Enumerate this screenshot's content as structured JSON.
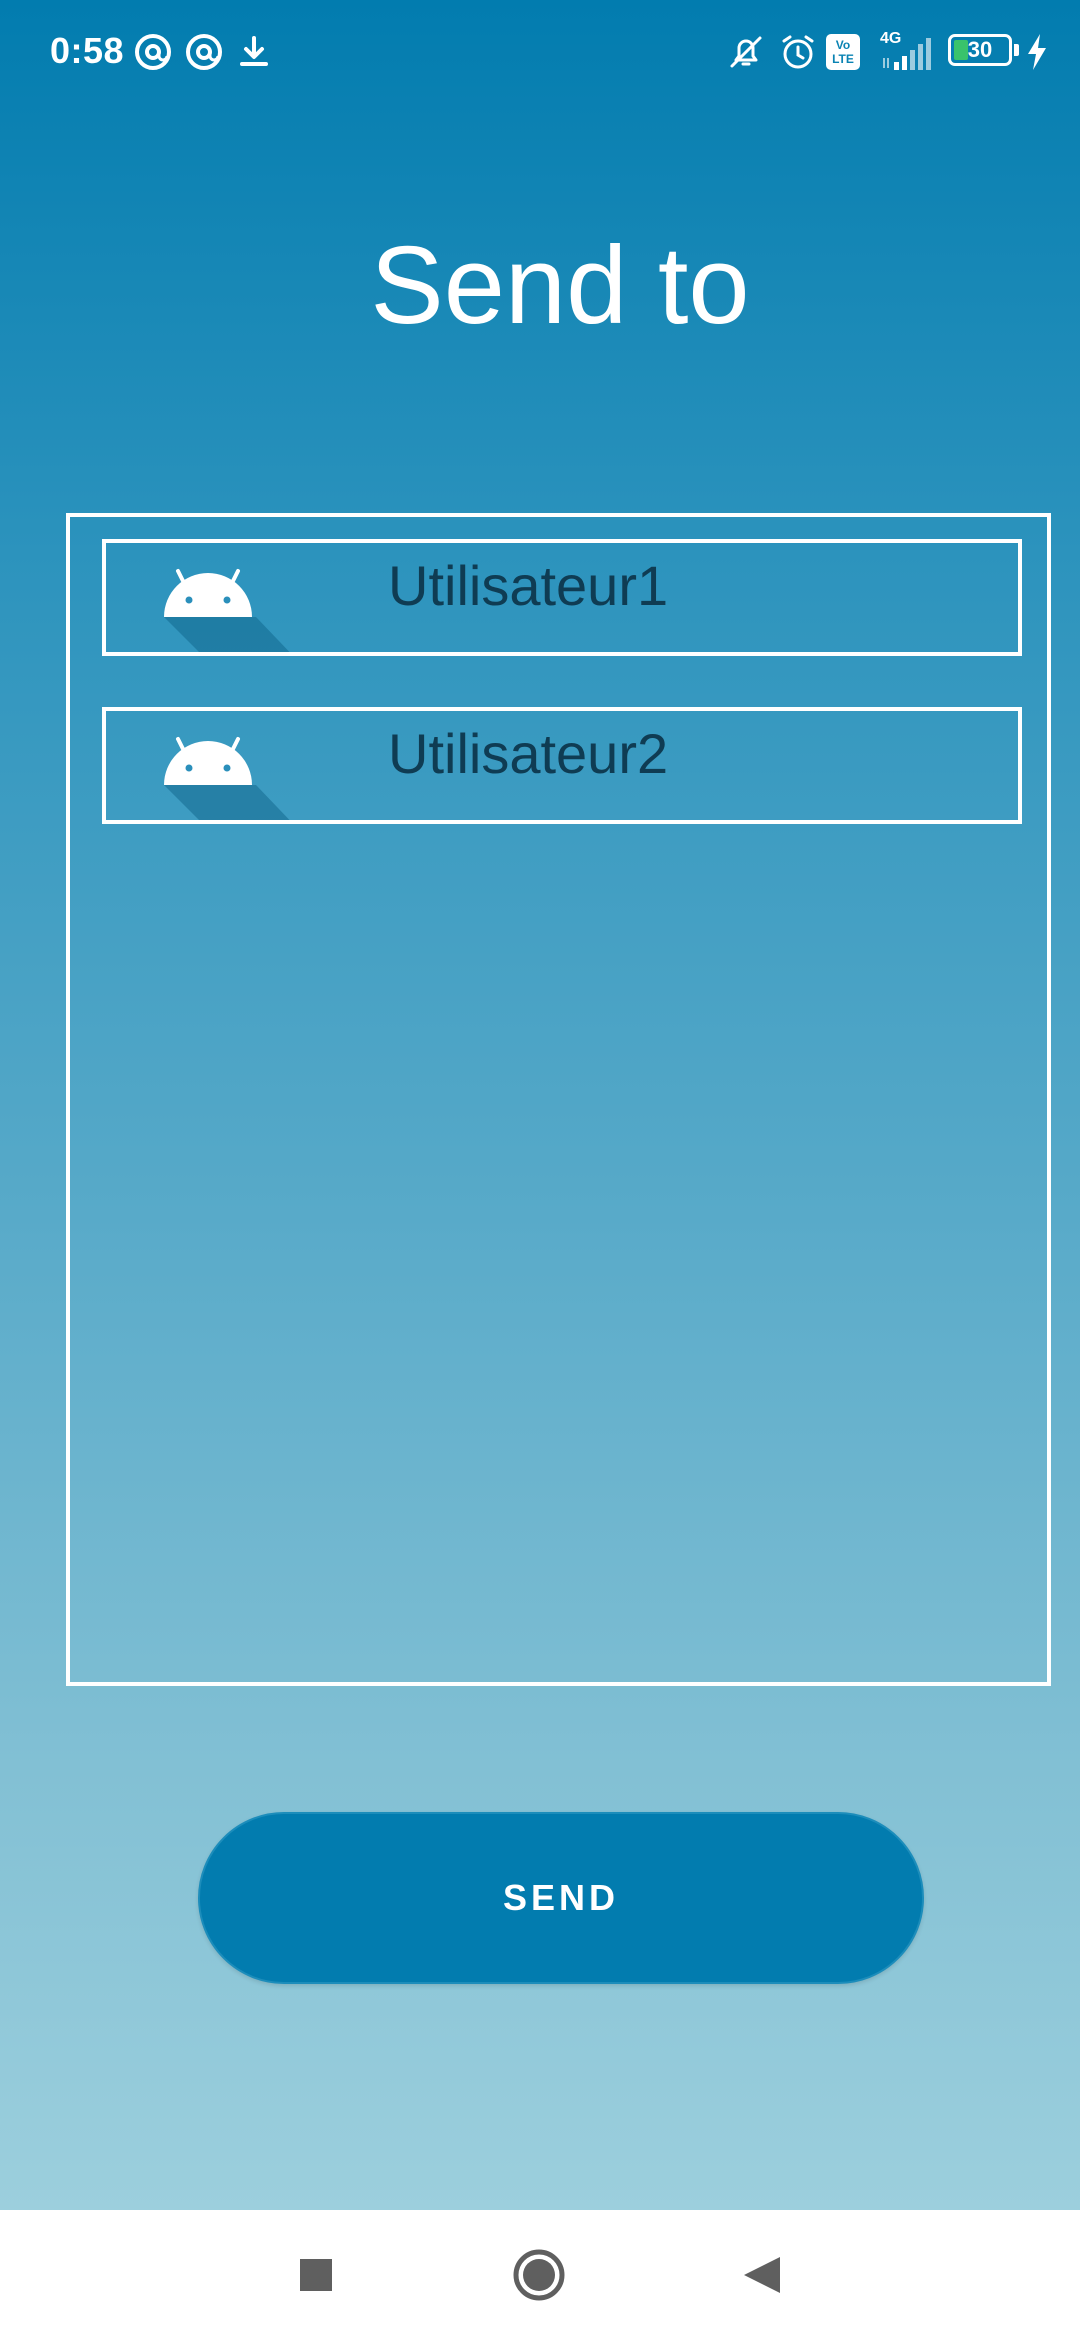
{
  "status_bar": {
    "time": "0:58",
    "battery_level": "30",
    "network_label": "4G",
    "volte_label": "Vo LTE",
    "icons": [
      "at-sign-icon",
      "at-sign-icon",
      "download-icon",
      "silent-bell-icon",
      "alarm-icon",
      "volte-icon",
      "signal-icon",
      "battery-icon",
      "charging-icon"
    ],
    "battery_fill_color": "#39c36b"
  },
  "page": {
    "title": "Send to"
  },
  "recipients": [
    {
      "name": "Utilisateur1",
      "icon": "android-icon"
    },
    {
      "name": "Utilisateur2",
      "icon": "android-icon"
    }
  ],
  "send_button": {
    "label": "SEND",
    "color": "#027caf"
  },
  "nav_bar": {
    "buttons": [
      "recents-icon",
      "home-icon",
      "back-icon"
    ]
  },
  "colors": {
    "gradient_top": "#027caf",
    "gradient_bottom": "#9ccfdd",
    "item_text": "#0f3c53"
  }
}
